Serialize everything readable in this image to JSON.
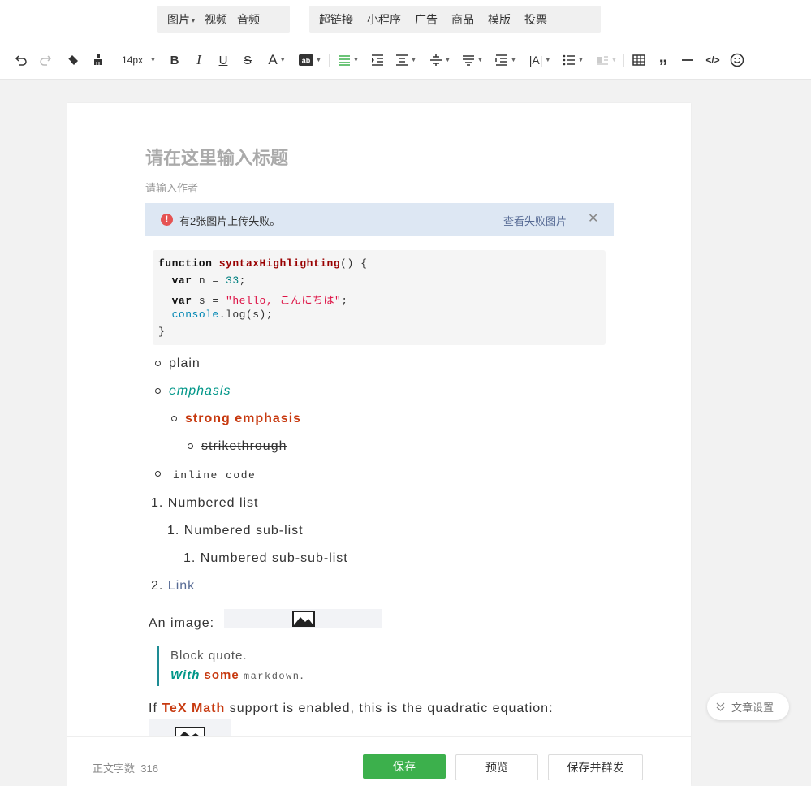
{
  "insert_bar": {
    "group1": [
      "图片",
      "视频",
      "音频"
    ],
    "group2": [
      "超链接",
      "小程序",
      "广告",
      "商品",
      "模版",
      "投票"
    ]
  },
  "toolbar": {
    "font_size": "14px"
  },
  "editor": {
    "title_placeholder": "请在这里输入标题",
    "author_placeholder": "请输入作者",
    "alert": {
      "message": "有2张图片上传失败。",
      "link": "查看失败图片"
    },
    "code": {
      "line1_kw": "function",
      "line1_fn": "syntaxHighlighting",
      "line1_rest": "() {",
      "line2_kw": "var",
      "line2_mid": " n = ",
      "line2_num": "33",
      "line2_end": ";",
      "line3_kw": "var",
      "line3_mid": " s = ",
      "line3_str": "\"hello, こんにちは\"",
      "line3_end": ";",
      "line4_obj": "console",
      "line4_rest": ".log(s);",
      "line5": "}"
    },
    "list": {
      "plain": "plain",
      "emphasis": "emphasis",
      "strong": "strong emphasis",
      "strike": "strikethrough",
      "inline_code": "inline code",
      "num1_marker": "1.",
      "num1": "Numbered list",
      "num1_1_marker": "1.",
      "num1_1": "Numbered sub-list",
      "num1_1_1_marker": "1.",
      "num1_1_1": "Numbered sub-sub-list",
      "num2_marker": "2.",
      "num2": "Link"
    },
    "image_label": "An image:",
    "quote": {
      "line1": "Block quote.",
      "with": "With",
      "some": "some",
      "markdown": "markdown",
      "dot": "."
    },
    "tex": {
      "prefix": "If",
      "strong": "TeX Math",
      "rest": "support is enabled, this is the quadratic equation:"
    }
  },
  "footer": {
    "word_count_label": "正文字数",
    "word_count_value": "316",
    "save": "保存",
    "preview": "预览",
    "save_broadcast": "保存并群发"
  },
  "settings_button": "文章设置",
  "colors": {
    "primary_green": "#3cb04c",
    "link_blue": "#576b95",
    "emphasis_teal": "#009688",
    "strong_red": "#c7390f",
    "alert_bg": "#dde7f3",
    "error_red": "#e55353"
  }
}
